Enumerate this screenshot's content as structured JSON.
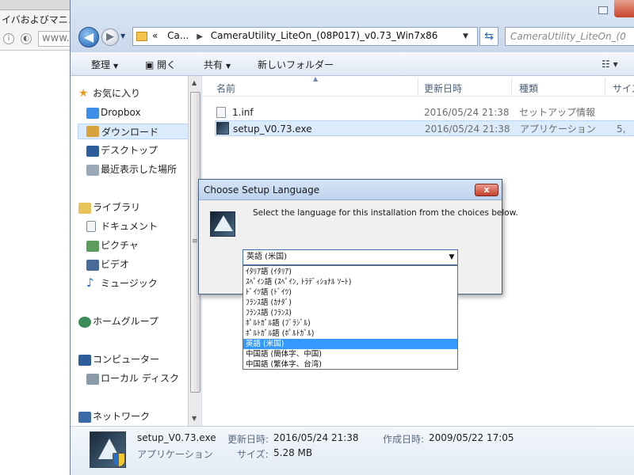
{
  "browser": {
    "tab_title": "イバおよびマニュ",
    "url_text": "www.a",
    "info_icon": "info-icon",
    "shield_icon": "shield-icon"
  },
  "explorer": {
    "breadcrumb": {
      "overflow": "«",
      "items": [
        "Ca...",
        "CameraUtility_LiteOn_(08P017)_v0.73_Win7x86"
      ]
    },
    "search_placeholder": "CameraUtility_LiteOn_(0",
    "toolbar": {
      "organize": "整理",
      "open": "開く",
      "share": "共有",
      "new_folder": "新しいフォルダー"
    },
    "nav": {
      "favorites": "お気に入り",
      "dropbox": "Dropbox",
      "downloads": "ダウンロード",
      "desktop": "デスクトップ",
      "recent": "最近表示した場所",
      "libraries": "ライブラリ",
      "documents": "ドキュメント",
      "pictures": "ピクチャ",
      "videos": "ビデオ",
      "music": "ミュージック",
      "homegroup": "ホームグループ",
      "computer": "コンピューター",
      "local_disk": "ローカル ディスク",
      "network": "ネットワーク"
    },
    "columns": {
      "name": "名前",
      "date": "更新日時",
      "type": "種類",
      "size": "サイズ"
    },
    "files": [
      {
        "name": "1.inf",
        "date": "2016/05/24 21:38",
        "type": "セットアップ情報",
        "size": ""
      },
      {
        "name": "setup_V0.73.exe",
        "date": "2016/05/24 21:38",
        "type": "アプリケーション",
        "size": "5,"
      }
    ],
    "details": {
      "filename": "setup_V0.73.exe",
      "modified_label": "更新日時:",
      "modified_value": "2016/05/24 21:38",
      "created_label": "作成日時:",
      "created_value": "2009/05/22 17:05",
      "type": "アプリケーション",
      "size_label": "サイズ:",
      "size_value": "5.28 MB"
    }
  },
  "dialog": {
    "title": "Choose Setup Language",
    "close_label": "x",
    "message": "Select the language for this installation from the choices below.",
    "selected": "英語 (米国)",
    "options": [
      "ｲﾀﾘｱ語 (ｲﾀﾘｱ)",
      "ｽﾍﾟｲﾝ語 (ｽﾍﾟｲﾝ, ﾄﾗﾃﾞｨｼｮﾅﾙ ｿｰﾄ)",
      "ﾄﾞｲﾂ語 (ﾄﾞｲﾂ)",
      "ﾌﾗﾝｽ語 (ｶﾅﾀﾞ)",
      "ﾌﾗﾝｽ語 (ﾌﾗﾝｽ)",
      "ﾎﾟﾙﾄｶﾞﾙ語 (ﾌﾞﾗｼﾞﾙ)",
      "ﾎﾟﾙﾄｶﾞﾙ語 (ﾎﾟﾙﾄｶﾞﾙ)",
      "英語 (米国)",
      "中国語 (簡体字、中国)",
      "中国語 (繁体字、台湾)"
    ],
    "highlight_color": "#3399ff"
  }
}
